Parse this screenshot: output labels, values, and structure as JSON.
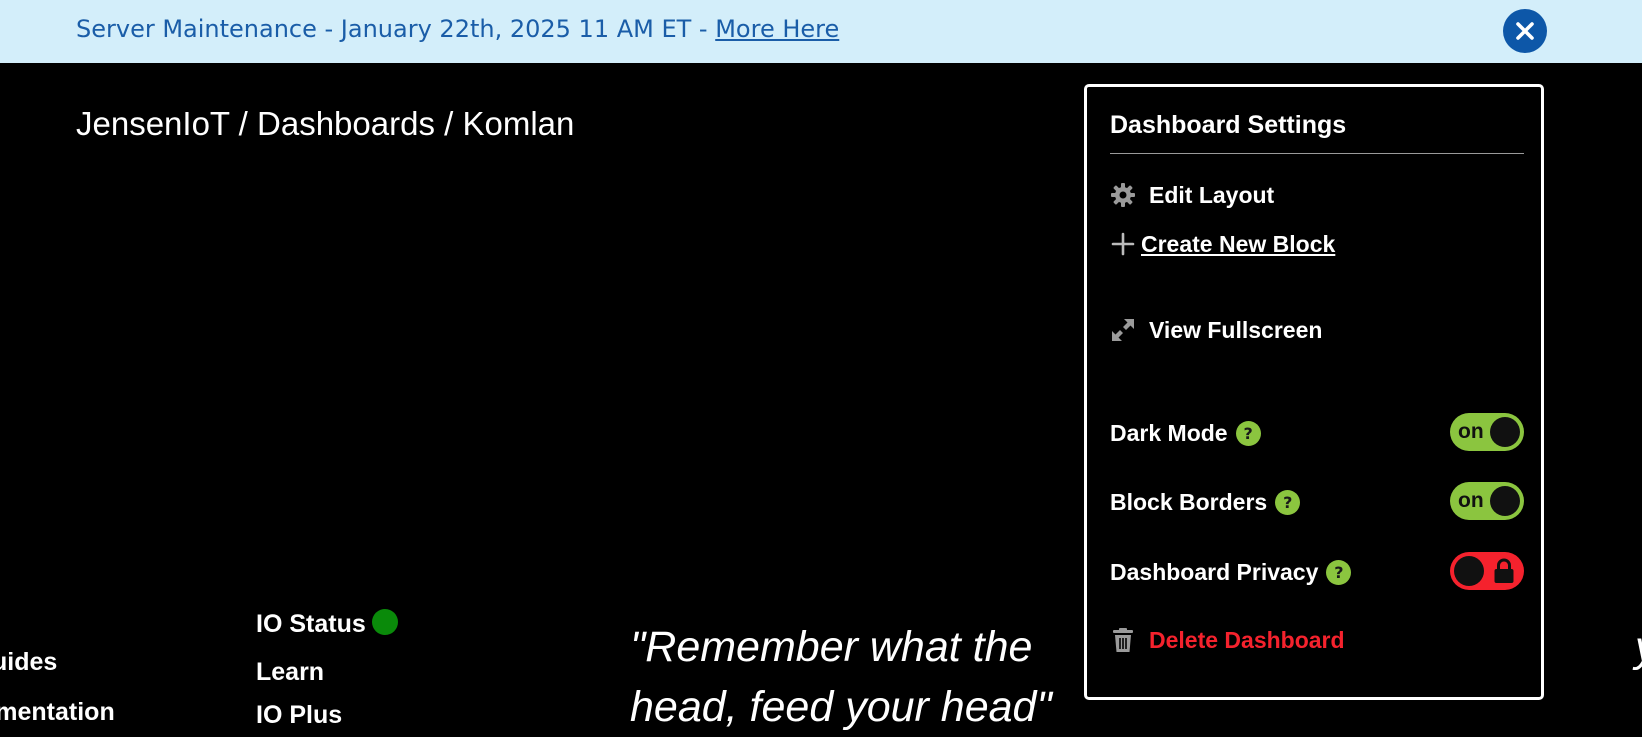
{
  "banner": {
    "message": "Server Maintenance - January 22th, 2025 11 AM ET - ",
    "link_label": "More Here",
    "background": "#d3eefa",
    "text_color": "#1a5da8",
    "close_icon": "close-icon"
  },
  "breadcrumb": {
    "items": [
      "JensenIoT",
      "Dashboards",
      "Komlan"
    ],
    "separator": " / "
  },
  "settings": {
    "title": "Dashboard Settings",
    "actions": [
      {
        "label": "Edit Layout",
        "icon": "gear-icon"
      },
      {
        "label": "Create New Block",
        "icon": "plus-icon"
      },
      {
        "label": "View Fullscreen",
        "icon": "expand-icon"
      }
    ],
    "toggles": [
      {
        "label": "Dark Mode",
        "state": "on",
        "help": "?"
      },
      {
        "label": "Block Borders",
        "state": "on",
        "help": "?"
      },
      {
        "label": "Dashboard Privacy",
        "state": "off",
        "help": "?",
        "icon": "lock-icon"
      }
    ],
    "delete_label": "Delete Dashboard",
    "accent_green": "#8bc53f",
    "danger_red": "#f5222d"
  },
  "footer": {
    "col1": [
      "uides",
      "umentation"
    ],
    "col2": [
      "IO Status",
      "Learn",
      "IO Plus"
    ],
    "quote_line1": "\"Remember what the ",
    "quote_line1_end": "your",
    "quote_line2": "head, feed your head\""
  }
}
